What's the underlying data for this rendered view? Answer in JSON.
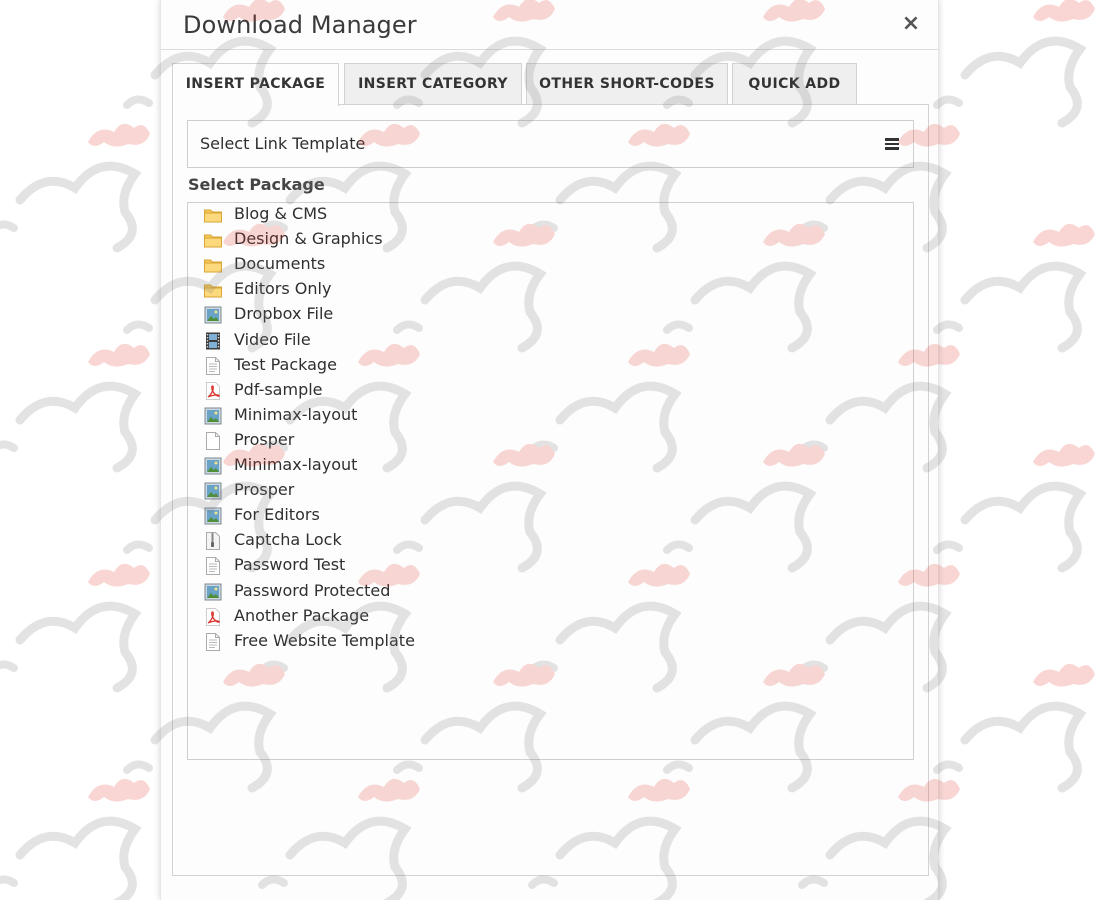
{
  "dialog": {
    "title": "Download Manager",
    "close_symbol": "×"
  },
  "tabs": [
    {
      "label": "INSERT PACKAGE",
      "active": true
    },
    {
      "label": "INSERT CATEGORY",
      "active": false
    },
    {
      "label": "OTHER SHORT-CODES",
      "active": false
    },
    {
      "label": "QUICK ADD",
      "active": false
    }
  ],
  "link_template": {
    "label": "Select Link Template",
    "icon": "menu-icon"
  },
  "package_section": {
    "label": "Select Package",
    "items": [
      {
        "label": "Blog & CMS",
        "icon": "folder-icon"
      },
      {
        "label": "Design & Graphics",
        "icon": "folder-icon"
      },
      {
        "label": "Documents",
        "icon": "folder-icon"
      },
      {
        "label": "Editors Only",
        "icon": "folder-icon"
      },
      {
        "label": "Dropbox File",
        "icon": "image-file-icon"
      },
      {
        "label": "Video File",
        "icon": "video-file-icon"
      },
      {
        "label": "Test Package",
        "icon": "text-file-icon"
      },
      {
        "label": "Pdf-sample",
        "icon": "pdf-file-icon"
      },
      {
        "label": "Minimax-layout",
        "icon": "image-file-icon"
      },
      {
        "label": "Prosper",
        "icon": "blank-file-icon"
      },
      {
        "label": "Minimax-layout",
        "icon": "image-file-icon"
      },
      {
        "label": "Prosper",
        "icon": "image-file-icon"
      },
      {
        "label": "For Editors",
        "icon": "image-file-icon"
      },
      {
        "label": "Captcha Lock",
        "icon": "zip-file-icon"
      },
      {
        "label": "Password Test",
        "icon": "text-file-icon"
      },
      {
        "label": "Password Protected",
        "icon": "image-file-icon"
      },
      {
        "label": "Another Package",
        "icon": "pdf-file-icon"
      },
      {
        "label": "Free Website Template",
        "icon": "text-file-icon"
      }
    ]
  },
  "colors": {
    "folder": "#f7c85a",
    "pdf_red": "#d9312b",
    "watermark": "#e23a2f"
  }
}
